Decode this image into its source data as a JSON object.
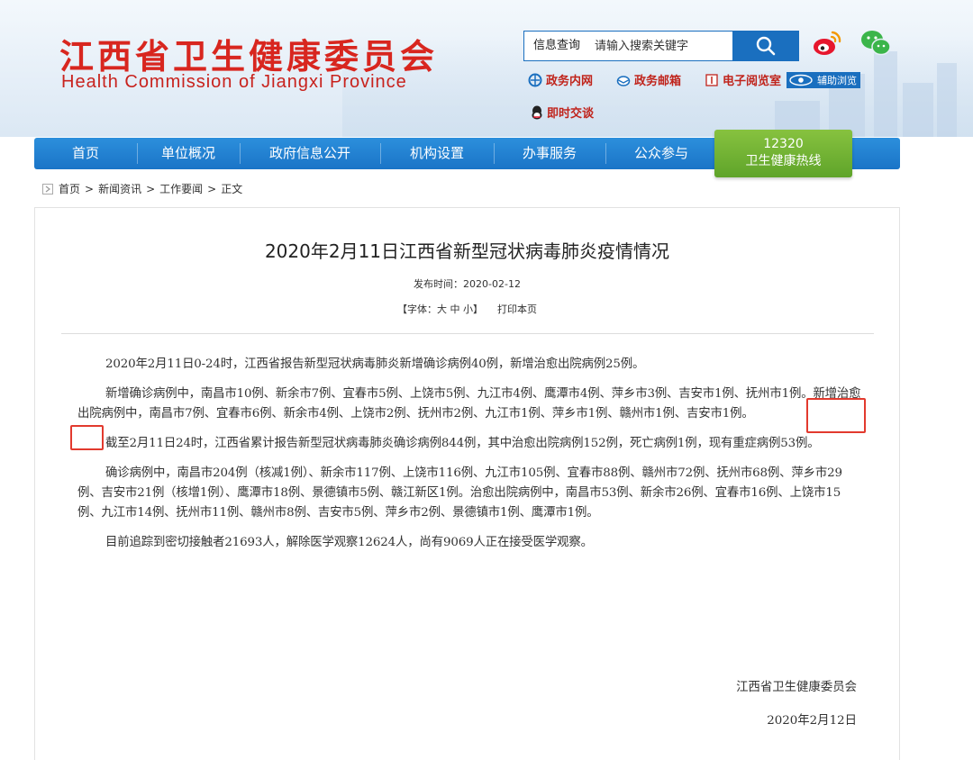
{
  "header": {
    "logo_cn": "江西省卫生健康委员会",
    "logo_en": "Health Commission of Jiangxi Province",
    "search": {
      "label": "信息查询",
      "placeholder": "请输入搜索关键字"
    },
    "links": {
      "intranet": "政务内网",
      "mail": "政务邮箱",
      "reading_room": "电子阅览室",
      "assist": "辅助浏览",
      "chat": "即时交谈"
    }
  },
  "nav": {
    "items": [
      "首页",
      "单位概况",
      "政府信息公开",
      "机构设置",
      "办事服务",
      "公众参与"
    ],
    "hotline": {
      "number": "12320",
      "label": "卫生健康热线"
    }
  },
  "breadcrumb": [
    "首页",
    "新闻资讯",
    "工作要闻",
    "正文"
  ],
  "article": {
    "title": "2020年2月11日江西省新型冠状病毒肺炎疫情情况",
    "publish_time": "发布时间：2020-02-12",
    "font_control": "【字体：大 中 小】",
    "print": "打印本页",
    "paragraphs": [
      "2020年2月11日0-24时，江西省报告新型冠状病毒肺炎新增确诊病例40例，新增治愈出院病例25例。",
      "新增确诊病例中，南昌市10例、新余市7例、宜春市5例、上饶市5例、九江市4例、鹰潭市4例、萍乡市3例、吉安市1例、抚州市1例。新增治愈出院病例中，南昌市7例、宜春市6例、新余市4例、上饶市2例、抚州市2例、九江市1例、萍乡市1例、赣州市1例、吉安市1例。",
      "截至2月11日24时，江西省累计报告新型冠状病毒肺炎确诊病例844例，其中治愈出院病例152例，死亡病例1例，现有重症病例53例。",
      "确诊病例中，南昌市204例（核减1例）、新余市117例、上饶市116例、九江市105例、宜春市88例、赣州市72例、抚州市68例、萍乡市29例、吉安市21例（核增1例）、鹰潭市18例、景德镇市5例、赣江新区1例。治愈出院病例中，南昌市53例、新余市26例、宜春市16例、上饶市15例、九江市14例、抚州市11例、赣州市8例、吉安市5例、萍乡市2例、景德镇市1例、鹰潭市1例。",
      "目前追踪到密切接触者21693人，解除医学观察12624人，尚有9069人正在接受医学观察。"
    ],
    "signature": "江西省卫生健康委员会",
    "date": "2020年2月12日"
  },
  "colors": {
    "brand_red": "#d8261f",
    "nav_blue": "#1a74c7",
    "hotline_green": "#6fb030",
    "highlight_red": "#e23a2e"
  }
}
